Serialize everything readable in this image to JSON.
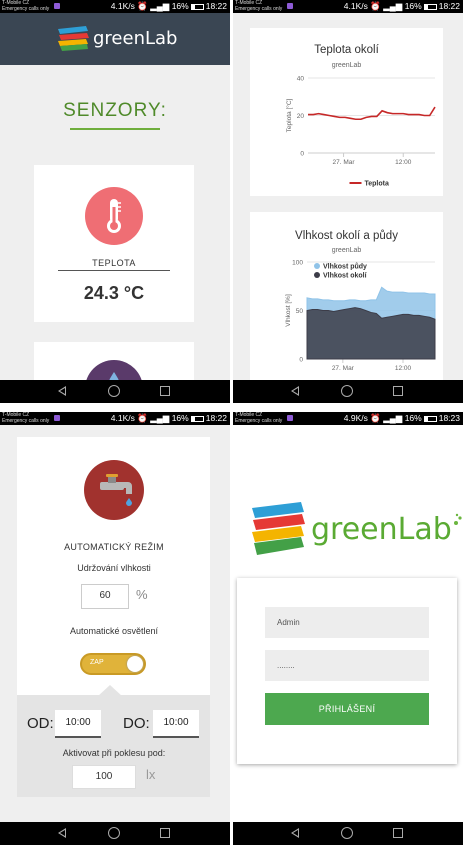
{
  "status_bar": {
    "carrier": "T-Mobile CZ",
    "emergency": "Emergency calls only",
    "panels": [
      {
        "speed": "4.1K/s",
        "battery": "16%",
        "time": "18:22"
      },
      {
        "speed": "4.1K/s",
        "battery": "16%",
        "time": "18:22"
      },
      {
        "speed": "4.1K/s",
        "battery": "16%",
        "time": "18:22"
      },
      {
        "speed": "4.9K/s",
        "battery": "16%",
        "time": "18:23"
      }
    ]
  },
  "app": {
    "logo_green": "green",
    "logo_lab": "Lab",
    "colors": {
      "brand_green": "#6bb63f",
      "header_bg": "#3a4653",
      "thermo": "#ef6e74",
      "faucet": "#a1322e",
      "toggle": "#e0b33a",
      "button": "#4da84f"
    }
  },
  "sensors_screen": {
    "title": "SENZORY:",
    "temperature": {
      "label": "TEPLOTA",
      "value": "24.3 °C",
      "icon": "thermometer-icon"
    }
  },
  "charts_screen": {
    "chart_data": [
      {
        "type": "line",
        "title": "Teplota okolí",
        "subtitle": "greenLab",
        "ylabel": "Teplota [°C]",
        "yticks": [
          0,
          20,
          40
        ],
        "ylim": [
          0,
          40
        ],
        "xticks": [
          "27. Mar",
          "12:00"
        ],
        "legend": "bottom",
        "series": [
          {
            "name": "Teplota",
            "color": "#c62828",
            "values": [
              20.5,
              20.5,
              21,
              20.5,
              20,
              19.5,
              19,
              19,
              18.5,
              18,
              18,
              19,
              19.5,
              19.5,
              22.5,
              21.5,
              21,
              21,
              21,
              20.5,
              20.5,
              20.5,
              20,
              20,
              24.5
            ]
          }
        ]
      },
      {
        "type": "area",
        "title": "Vlhkost okolí a půdy",
        "subtitle": "greenLab",
        "ylabel": "Vlhkost [%]",
        "yticks": [
          0,
          50,
          100
        ],
        "ylim": [
          0,
          100
        ],
        "xticks": [
          "27. Mar",
          "12:00"
        ],
        "legend": "top-left",
        "series": [
          {
            "name": "Vlhkost půdy",
            "color": "#90c3e8",
            "values": [
              63,
              62,
              62,
              61,
              61,
              60,
              60,
              60,
              61,
              61,
              60,
              60,
              61,
              61,
              74,
              70,
              69,
              69,
              69,
              68,
              68,
              68,
              68,
              67,
              67
            ]
          },
          {
            "name": "Vlhkost okolí",
            "color": "#3c3c48",
            "values": [
              50,
              51,
              51,
              50,
              50,
              49,
              50,
              51,
              52,
              53,
              52,
              50,
              48,
              47,
              42,
              43,
              44,
              45,
              46,
              46,
              45,
              45,
              44,
              43,
              41
            ]
          }
        ]
      }
    ]
  },
  "settings_screen": {
    "mode_label": "AUTOMATICKÝ REŽIM",
    "humidity_label": "Udržování vlhkosti",
    "humidity_value": "60",
    "humidity_unit": "%",
    "light_label": "Automatické osvětlení",
    "toggle_label": "ZAP",
    "toggle_on": true,
    "from_label": "OD:",
    "from_value": "10:00",
    "to_label": "DO:",
    "to_value": "10:00",
    "activate_label": "Aktivovat při poklesu pod:",
    "lux_value": "100",
    "lux_unit": "lx"
  },
  "login_screen": {
    "username": "Admin",
    "password": "........",
    "button": "PŘIHLÁŠENÍ"
  }
}
